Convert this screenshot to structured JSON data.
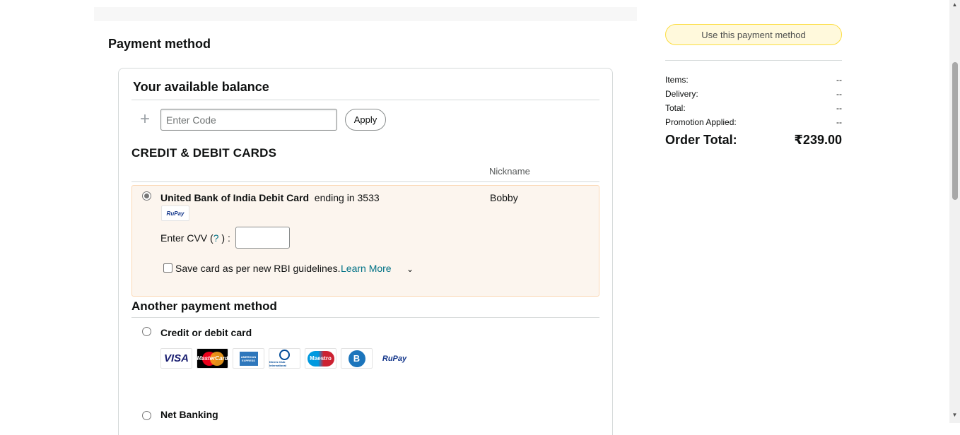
{
  "payment": {
    "section_title": "Payment method",
    "balance": {
      "heading": "Your available balance",
      "code_placeholder": "Enter Code",
      "apply_label": "Apply"
    },
    "cards": {
      "heading": "CREDIT & DEBIT CARDS",
      "nickname_header": "Nickname",
      "selected": {
        "bank_name": "United Bank of India Debit Card",
        "ending_text": "ending in 3533",
        "nickname": "Bobby",
        "network_logo": "RuPay",
        "cvv_label_prefix": "Enter CVV (",
        "cvv_help": "?",
        "cvv_label_suffix": ") :",
        "save_card_label": "Save card as per new RBI guidelines.",
        "learn_more": "Learn More"
      }
    },
    "another": {
      "heading": "Another payment method",
      "options": [
        {
          "label": "Credit or debit card"
        },
        {
          "label": "Net Banking"
        }
      ],
      "card_logos": [
        {
          "name": "visa-logo",
          "text": "VISA"
        },
        {
          "name": "mastercard-logo",
          "text": "MasterCard"
        },
        {
          "name": "amex-logo",
          "text": "AMERICAN EXPRESS"
        },
        {
          "name": "diners-club-logo",
          "text": "Diners Club International"
        },
        {
          "name": "maestro-logo",
          "text": "Maestro"
        },
        {
          "name": "bajaj-finserv-logo",
          "text": "B"
        },
        {
          "name": "rupay-logo",
          "text": "RuPay"
        }
      ]
    }
  },
  "summary": {
    "use_button": "Use this payment method",
    "rows": [
      {
        "label": "Items:",
        "value": "--"
      },
      {
        "label": "Delivery:",
        "value": "--"
      },
      {
        "label": "Total:",
        "value": "--"
      },
      {
        "label": "Promotion Applied:",
        "value": "--"
      }
    ],
    "order_total_label": "Order Total:",
    "order_total_value": "₹239.00"
  },
  "colors": {
    "selected_bg": "#fcf5ee",
    "selected_border": "#fbd8b4",
    "link": "#007185",
    "primary_button": "#ffd814"
  }
}
